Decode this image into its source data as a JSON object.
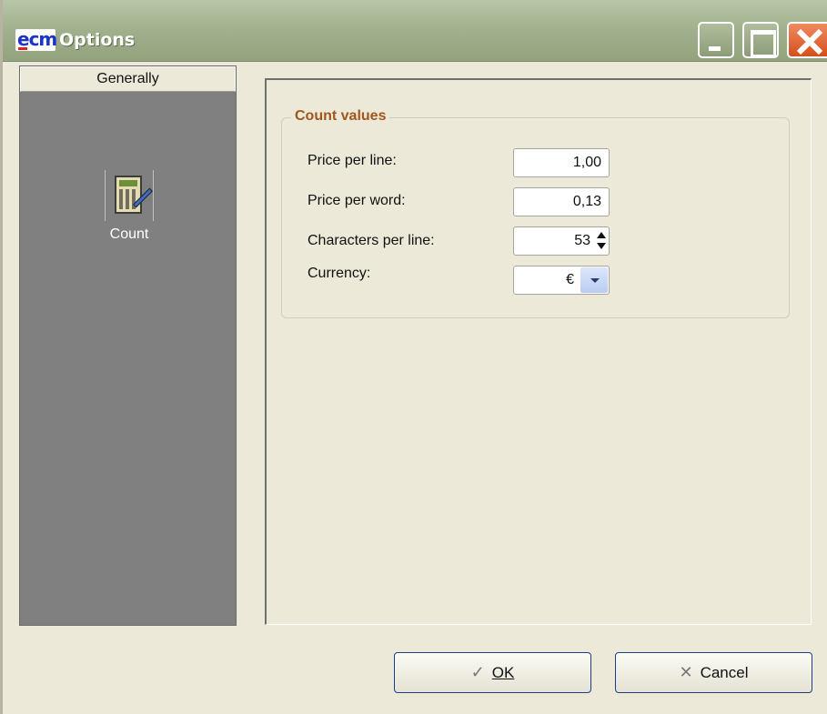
{
  "window": {
    "title": "Options",
    "logo_text": "ecm"
  },
  "nav": {
    "header": "Generally",
    "items": [
      {
        "label": "Count",
        "icon": "calculator-icon"
      }
    ]
  },
  "group": {
    "title": "Count values",
    "fields": [
      {
        "label": "Price per line:",
        "value": "1,00"
      },
      {
        "label": "Price per word:",
        "value": "0,13"
      },
      {
        "label": "Characters per line:",
        "value": "53"
      },
      {
        "label": "Currency:",
        "value": "€"
      }
    ]
  },
  "buttons": {
    "ok_icon": "✓",
    "ok": "OK",
    "cancel_icon": "✕",
    "cancel": "Cancel"
  },
  "colors": {
    "titlebar": "#a0b08c",
    "nav_background": "#808080",
    "group_title": "#a0561c",
    "close_button": "#d4501d"
  }
}
